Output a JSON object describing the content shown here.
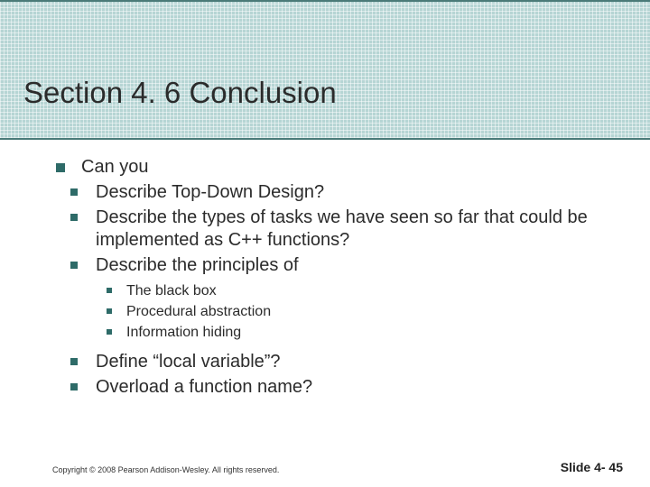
{
  "title": "Section 4. 6 Conclusion",
  "lvl1": "Can you",
  "lvl2a": "Describe Top-Down Design?",
  "lvl2b": "Describe the types of tasks we have seen so far that could be implemented as C++ functions?",
  "lvl2c": "Describe the principles of",
  "lvl3a": "The black box",
  "lvl3b": "Procedural abstraction",
  "lvl3c": "Information hiding",
  "lvl2d": "Define “local variable”?",
  "lvl2e": "Overload a function name?",
  "footer_left": "Copyright © 2008 Pearson Addison-Wesley. All rights reserved.",
  "footer_right": "Slide 4- 45"
}
